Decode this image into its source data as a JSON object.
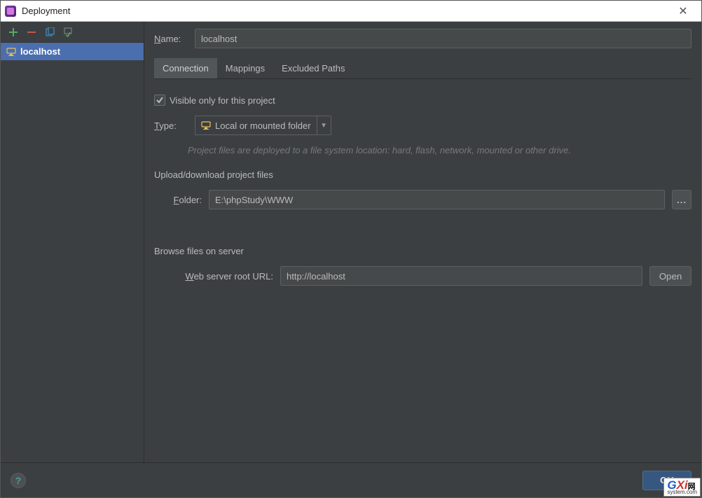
{
  "window": {
    "title": "Deployment",
    "close": "✕"
  },
  "sidebar": {
    "items": [
      {
        "label": "localhost"
      }
    ]
  },
  "form": {
    "name_label": "Name:",
    "name_value": "localhost"
  },
  "tabs": {
    "connection": "Connection",
    "mappings": "Mappings",
    "excluded": "Excluded Paths"
  },
  "connection": {
    "visible_checkbox": "Visible only for this project",
    "type_label": "Type:",
    "type_value": "Local or mounted folder",
    "type_hint": "Project files are deployed to a file system location: hard, flash, network, mounted or other drive.",
    "upload_section": "Upload/download project files",
    "folder_label": "Folder:",
    "folder_value": "E:\\phpStudy\\WWW",
    "browse_btn": "...",
    "browse_section": "Browse files on server",
    "url_label": "Web server root URL:",
    "url_value": "http://localhost",
    "open_btn": "Open"
  },
  "footer": {
    "help": "?",
    "ok": "OK"
  },
  "watermark": {
    "brand1": "G",
    "brand2": "Xi",
    "brand3": "网",
    "sub": "system.com"
  }
}
